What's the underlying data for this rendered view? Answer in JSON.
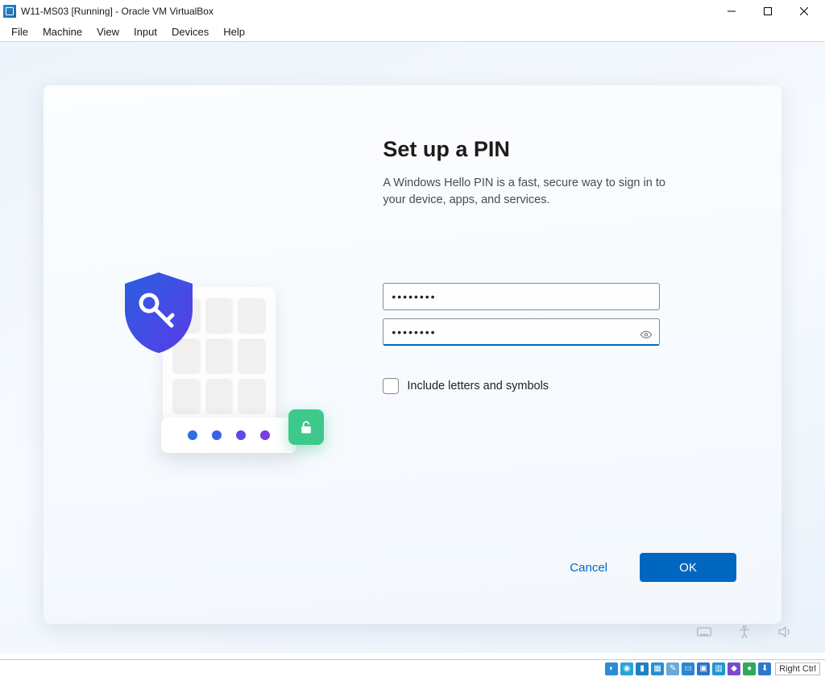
{
  "titlebar": {
    "title": "W11-MS03 [Running] - Oracle VM VirtualBox"
  },
  "menubar": {
    "items": [
      "File",
      "Machine",
      "View",
      "Input",
      "Devices",
      "Help"
    ]
  },
  "dialog": {
    "heading": "Set up a PIN",
    "description": "A Windows Hello PIN is a fast, secure way to sign in to your device, apps, and services.",
    "pin_value": "••••••••",
    "confirm_value": "••••••••",
    "checkbox_label": "Include letters and symbols",
    "cancel_label": "Cancel",
    "ok_label": "OK"
  },
  "illustration": {
    "dot_colors": [
      "#2f6fe0",
      "#3a62e6",
      "#5a4ce4",
      "#7a3ee0"
    ]
  },
  "statusbar": {
    "hostkey": "Right Ctrl"
  }
}
